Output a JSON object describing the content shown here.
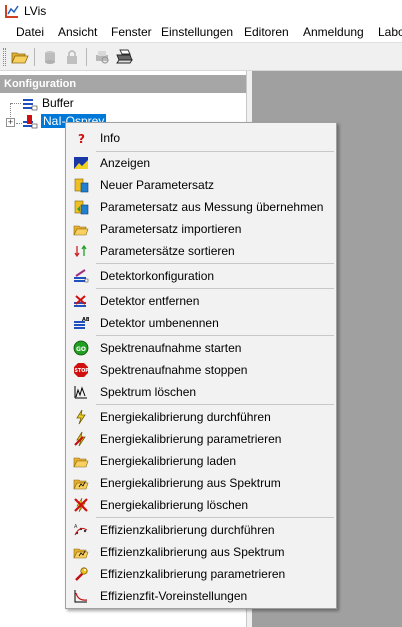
{
  "window": {
    "title": "LVis"
  },
  "menubar": {
    "items": [
      "Datei",
      "Ansicht",
      "Fenster",
      "Einstellungen",
      "Editoren",
      "Anmeldung",
      "Labo"
    ]
  },
  "toolbar": {
    "buttons": [
      "open-folder-icon",
      "cylinder-icon-disabled",
      "lock-icon-disabled",
      "printer-preview-icon",
      "printer-icon"
    ]
  },
  "config_panel": {
    "title": "Konfiguration",
    "tree": [
      {
        "label": "Buffer",
        "icon": "buffer-icon",
        "selected": false,
        "expandable": false
      },
      {
        "label": "NaI-Osprey",
        "icon": "detector-icon",
        "selected": true,
        "expandable": true,
        "expander_symbol": "+"
      }
    ]
  },
  "context_menu": {
    "groups": [
      [
        {
          "label": "Info",
          "icon": "question-icon"
        }
      ],
      [
        {
          "label": "Anzeigen",
          "icon": "display-icon"
        },
        {
          "label": "Neuer Parametersatz",
          "icon": "new-parameterset-icon"
        },
        {
          "label": "Parametersatz aus Messung übernehmen",
          "icon": "parameterset-from-measurement-icon"
        },
        {
          "label": "Parametersatz importieren",
          "icon": "import-folder-icon"
        },
        {
          "label": "Parametersätze sortieren",
          "icon": "sort-arrows-icon"
        }
      ],
      [
        {
          "label": "Detektorkonfiguration",
          "icon": "detector-config-icon"
        }
      ],
      [
        {
          "label": "Detektor entfernen",
          "icon": "detector-remove-icon"
        },
        {
          "label": "Detektor umbenennen",
          "icon": "detector-rename-icon"
        }
      ],
      [
        {
          "label": "Spektrenaufnahme starten",
          "icon": "go-icon"
        },
        {
          "label": "Spektrenaufnahme stoppen",
          "icon": "stop-icon"
        },
        {
          "label": "Spektrum löschen",
          "icon": "spectrum-delete-icon"
        }
      ],
      [
        {
          "label": "Energiekalibrierung durchführen",
          "icon": "lightning-icon"
        },
        {
          "label": "Energiekalibrierung parametrieren",
          "icon": "lightning-parameter-icon"
        },
        {
          "label": "Energiekalibrierung laden",
          "icon": "load-folder-icon"
        },
        {
          "label": "Energiekalibrierung aus Spektrum",
          "icon": "folder-spectrum-icon"
        },
        {
          "label": "Energiekalibrierung löschen",
          "icon": "delete-x-icon"
        }
      ],
      [
        {
          "label": "Effizienzkalibrierung durchführen",
          "icon": "efficiency-icon"
        },
        {
          "label": "Effizienzkalibrierung aus Spektrum",
          "icon": "folder-spectrum-icon"
        },
        {
          "label": "Effizienzkalibrierung parametrieren",
          "icon": "wrench-icon"
        },
        {
          "label": "Effizienzfit-Voreinstellungen",
          "icon": "curve-fit-icon"
        }
      ]
    ]
  },
  "colors": {
    "selection": "#0078d7",
    "panel_header": "#a6a6a6",
    "workspace": "#a0a0a0",
    "menu_background": "#f2f2f2"
  }
}
